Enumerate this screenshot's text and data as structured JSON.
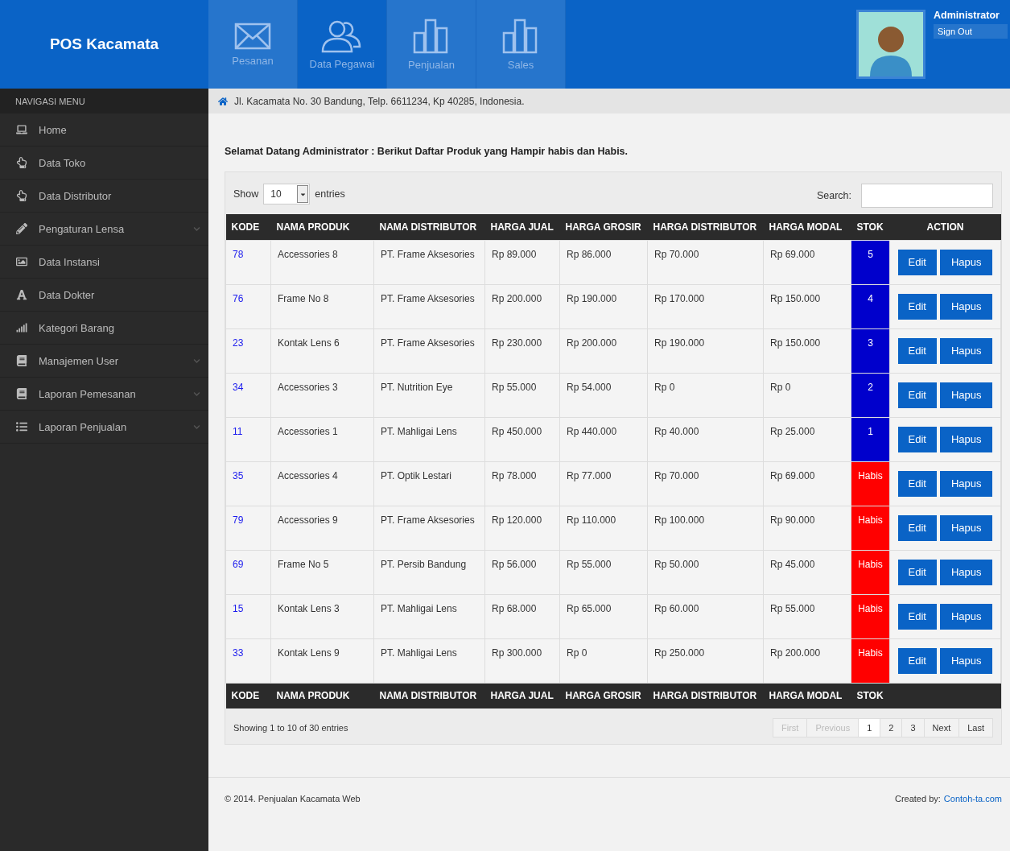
{
  "brand": "POS Kacamata",
  "top_nav": [
    {
      "label": "Pesanan",
      "selected": false
    },
    {
      "label": "Data Pegawai",
      "selected": true
    },
    {
      "label": "Penjualan",
      "selected": false
    },
    {
      "label": "Sales",
      "selected": false
    }
  ],
  "user": {
    "name": "Administrator",
    "sign_out": "Sign Out"
  },
  "sidebar": {
    "title": "NAVIGASI MENU",
    "items": [
      {
        "label": "Home",
        "has_submenu": false
      },
      {
        "label": "Data Toko",
        "has_submenu": false
      },
      {
        "label": "Data Distributor",
        "has_submenu": false
      },
      {
        "label": "Pengaturan Lensa",
        "has_submenu": true
      },
      {
        "label": "Data Instansi",
        "has_submenu": false
      },
      {
        "label": "Data Dokter",
        "has_submenu": false
      },
      {
        "label": "Kategori Barang",
        "has_submenu": false
      },
      {
        "label": "Manajemen User",
        "has_submenu": true
      },
      {
        "label": "Laporan Pemesanan",
        "has_submenu": true
      },
      {
        "label": "Laporan Penjualan",
        "has_submenu": true
      }
    ]
  },
  "address": "Jl. Kacamata No. 30 Bandung, Telp. 6611234, Kp 40285, Indonesia.",
  "welcome": "Selamat Datang Administrator : Berikut Daftar Produk yang Hampir habis dan Habis.",
  "table_controls": {
    "show_label": "Show",
    "page_size": "10",
    "entries_label": "entries",
    "search_label": "Search:"
  },
  "table": {
    "columns": [
      "KODE",
      "NAMA PRODUK",
      "NAMA DISTRIBUTOR",
      "HARGA JUAL",
      "HARGA GROSIR",
      "HARGA DISTRIBUTOR",
      "HARGA MODAL",
      "STOK",
      "ACTION"
    ],
    "footer_columns": [
      "KODE",
      "NAMA PRODUK",
      "NAMA DISTRIBUTOR",
      "HARGA JUAL",
      "HARGA GROSIR",
      "HARGA DISTRIBUTOR",
      "HARGA MODAL",
      "STOK"
    ],
    "rows": [
      {
        "kode": "78",
        "produk": "Accessories 8",
        "distributor": "PT. Frame Aksesories",
        "jual": "Rp 89.000",
        "grosir": "Rp 86.000",
        "harga_distributor": "Rp 70.000",
        "modal": "Rp 69.000",
        "stok": "5",
        "color": "#0000cc",
        "actions": [
          "Edit",
          "Hapus"
        ]
      },
      {
        "kode": "76",
        "produk": "Frame No 8",
        "distributor": "PT. Frame Aksesories",
        "jual": "Rp 200.000",
        "grosir": "Rp 190.000",
        "harga_distributor": "Rp 170.000",
        "modal": "Rp 150.000",
        "stok": "4",
        "color": "#0000cc",
        "actions": [
          "Edit",
          "Hapus"
        ]
      },
      {
        "kode": "23",
        "produk": "Kontak Lens 6",
        "distributor": "PT. Frame Aksesories",
        "jual": "Rp 230.000",
        "grosir": "Rp 200.000",
        "harga_distributor": "Rp 190.000",
        "modal": "Rp 150.000",
        "stok": "3",
        "color": "#0000cc",
        "actions": [
          "Edit",
          "Hapus"
        ]
      },
      {
        "kode": "34",
        "produk": "Accessories 3",
        "distributor": "PT. Nutrition Eye",
        "jual": "Rp 55.000",
        "grosir": "Rp 54.000",
        "harga_distributor": "Rp 0",
        "modal": "Rp 0",
        "stok": "2",
        "color": "#0000cc",
        "actions": [
          "Edit",
          "Hapus"
        ]
      },
      {
        "kode": "11",
        "produk": "Accessories 1",
        "distributor": "PT. Mahligai Lens",
        "jual": "Rp 450.000",
        "grosir": "Rp 440.000",
        "harga_distributor": "Rp 40.000",
        "modal": "Rp 25.000",
        "stok": "1",
        "color": "#0000cc",
        "actions": [
          "Edit",
          "Hapus"
        ]
      },
      {
        "kode": "35",
        "produk": "Accessories 4",
        "distributor": "PT. Optik Lestari",
        "jual": "Rp 78.000",
        "grosir": "Rp 77.000",
        "harga_distributor": "Rp 70.000",
        "modal": "Rp 69.000",
        "stok": "Habis",
        "color": "#ff0000",
        "actions": [
          "Edit",
          "Hapus"
        ]
      },
      {
        "kode": "79",
        "produk": "Accessories 9",
        "distributor": "PT. Frame Aksesories",
        "jual": "Rp 120.000",
        "grosir": "Rp 110.000",
        "harga_distributor": "Rp 100.000",
        "modal": "Rp 90.000",
        "stok": "Habis",
        "color": "#ff0000",
        "actions": [
          "Edit",
          "Hapus"
        ]
      },
      {
        "kode": "69",
        "produk": "Frame No 5",
        "distributor": "PT. Persib Bandung",
        "jual": "Rp 56.000",
        "grosir": "Rp 55.000",
        "harga_distributor": "Rp 50.000",
        "modal": "Rp 45.000",
        "stok": "Habis",
        "color": "#ff0000",
        "actions": [
          "Edit",
          "Hapus"
        ]
      },
      {
        "kode": "15",
        "produk": "Kontak Lens 3",
        "distributor": "PT. Mahligai Lens",
        "jual": "Rp 68.000",
        "grosir": "Rp 65.000",
        "harga_distributor": "Rp 60.000",
        "modal": "Rp 55.000",
        "stok": "Habis",
        "color": "#ff0000",
        "actions": [
          "Edit",
          "Hapus"
        ]
      },
      {
        "kode": "33",
        "produk": "Kontak Lens 9",
        "distributor": "PT. Mahligai Lens",
        "jual": "Rp 300.000",
        "grosir": "Rp 0",
        "harga_distributor": "Rp 250.000",
        "modal": "Rp 200.000",
        "stok": "Habis",
        "color": "#ff0000",
        "actions": [
          "Edit",
          "Hapus"
        ]
      }
    ]
  },
  "info": "Showing 1 to 10 of 30 entries",
  "pagination": [
    {
      "label": "First",
      "disabled": true,
      "selected": false
    },
    {
      "label": "Previous",
      "disabled": true,
      "selected": false
    },
    {
      "label": "1",
      "disabled": false,
      "selected": true
    },
    {
      "label": "2",
      "disabled": false,
      "selected": false
    },
    {
      "label": "3",
      "disabled": false,
      "selected": false
    },
    {
      "label": "Next",
      "disabled": false,
      "selected": false
    },
    {
      "label": "Last",
      "disabled": false,
      "selected": false
    }
  ],
  "footer": {
    "copyright": "© 2014. Penjualan Kacamata Web",
    "created_label": "Created by:",
    "created_link": "Contoh-ta.com"
  }
}
